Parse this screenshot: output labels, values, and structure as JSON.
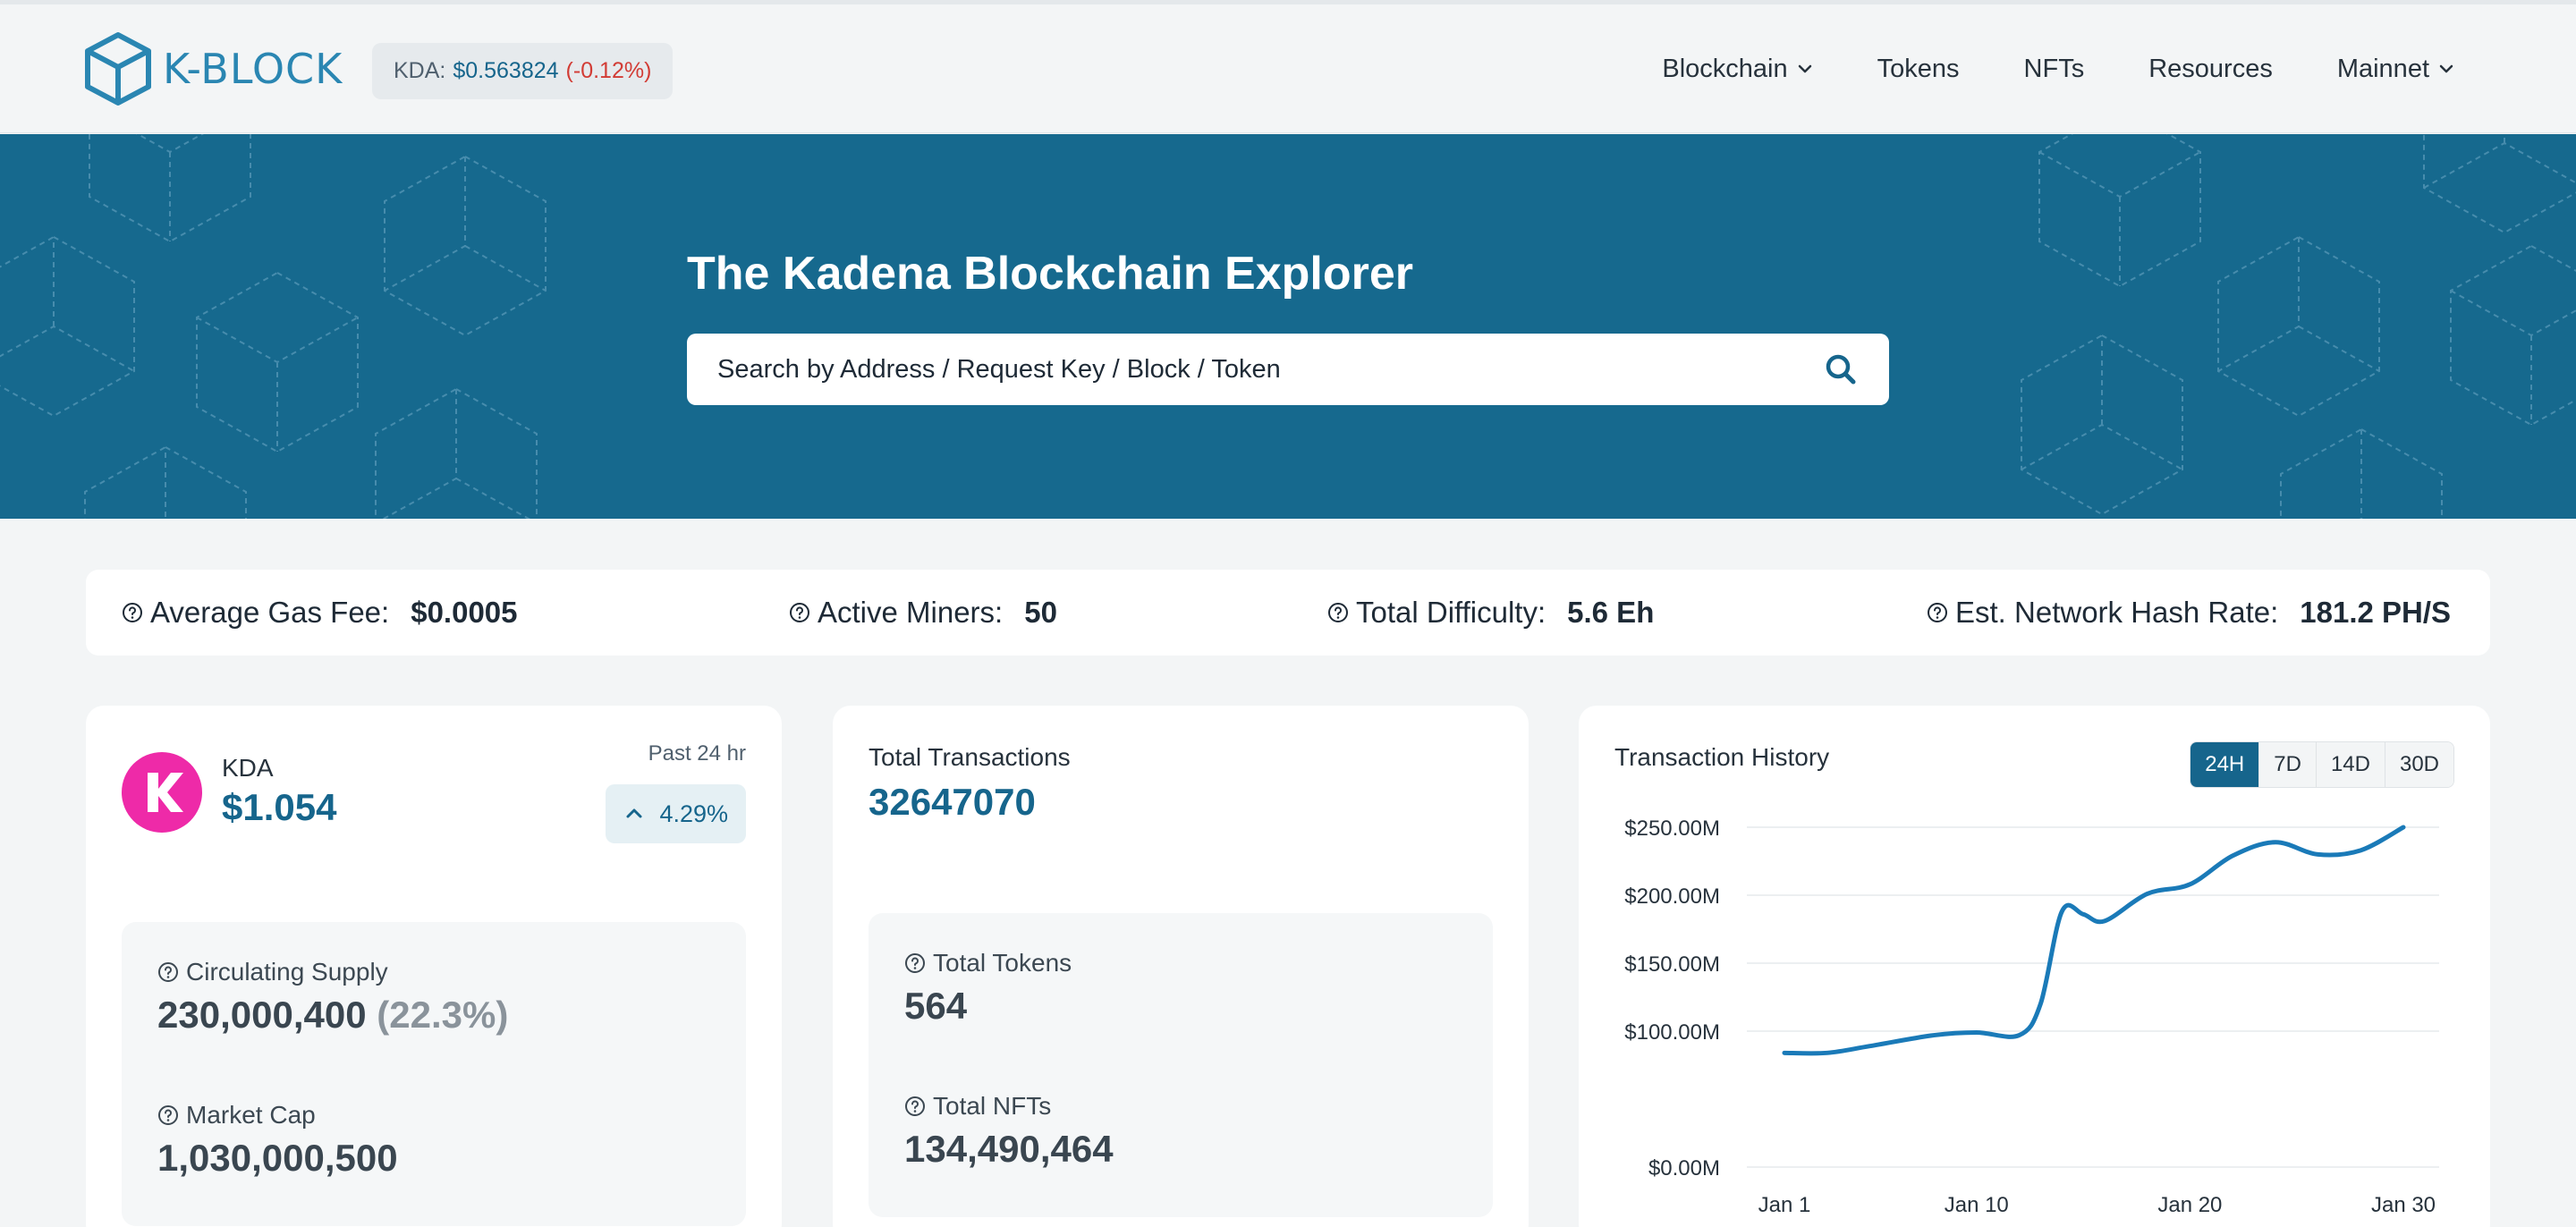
{
  "header": {
    "logo_text": "K-BLOCK",
    "price_label": "KDA:",
    "price_value": "$0.563824",
    "price_change": "(-0.12%)",
    "nav": [
      {
        "label": "Blockchain",
        "dropdown": true
      },
      {
        "label": "Tokens",
        "dropdown": false
      },
      {
        "label": "NFTs",
        "dropdown": false
      },
      {
        "label": "Resources",
        "dropdown": false
      },
      {
        "label": "Mainnet",
        "dropdown": true
      }
    ]
  },
  "hero": {
    "title": "The Kadena Blockchain Explorer",
    "search_placeholder": "Search by Address / Request Key / Block / Token"
  },
  "stats": [
    {
      "label": "Average Gas Fee:",
      "value": "$0.0005"
    },
    {
      "label": "Active Miners:",
      "value": "50"
    },
    {
      "label": "Total Difficulty:",
      "value": "5.6 Eh"
    },
    {
      "label": "Est. Network Hash Rate:",
      "value": "181.2 PH/S"
    }
  ],
  "kda_card": {
    "logo_letter": "K",
    "name": "KDA",
    "price": "$1.054",
    "period": "Past 24 hr",
    "change": "4.29%",
    "circulating_label": "Circulating Supply",
    "circulating_value": "230,000,400",
    "circulating_pct": "(22.3%)",
    "market_cap_label": "Market Cap",
    "market_cap_value": "1,030,000,500"
  },
  "tx_card": {
    "total_tx_label": "Total Transactions",
    "total_tx_value": "32647070",
    "tokens_label": "Total Tokens",
    "tokens_value": "564",
    "nfts_label": "Total NFTs",
    "nfts_value": "134,490,464"
  },
  "history_card": {
    "title": "Transaction History",
    "ranges": [
      "24H",
      "7D",
      "14D",
      "30D"
    ],
    "active_range": "24H"
  },
  "colors": {
    "brand": "#16658c",
    "hero": "#16698e",
    "negative": "#d23c35",
    "kda_pink": "#ee2aa8",
    "line": "#1a7ab8"
  },
  "chart_data": {
    "type": "line",
    "title": "Transaction History",
    "xlabel": "",
    "ylabel": "",
    "x_ticks": [
      "Jan 1",
      "Jan 10",
      "Jan 20",
      "Jan 30"
    ],
    "y_ticks": [
      "$0.00M",
      "$100.00M",
      "$150.00M",
      "$200.00M",
      "$250.00M"
    ],
    "ylim": [
      0,
      250
    ],
    "grid": true,
    "series": [
      {
        "x": [
          1,
          3,
          5,
          8,
          10,
          12,
          13,
          14,
          15,
          16,
          18,
          20,
          22,
          24,
          26,
          28,
          30
        ],
        "values": [
          84,
          84,
          89,
          97,
          99,
          97,
          120,
          188,
          186,
          181,
          201,
          208,
          229,
          239,
          230,
          233,
          250
        ]
      }
    ]
  }
}
